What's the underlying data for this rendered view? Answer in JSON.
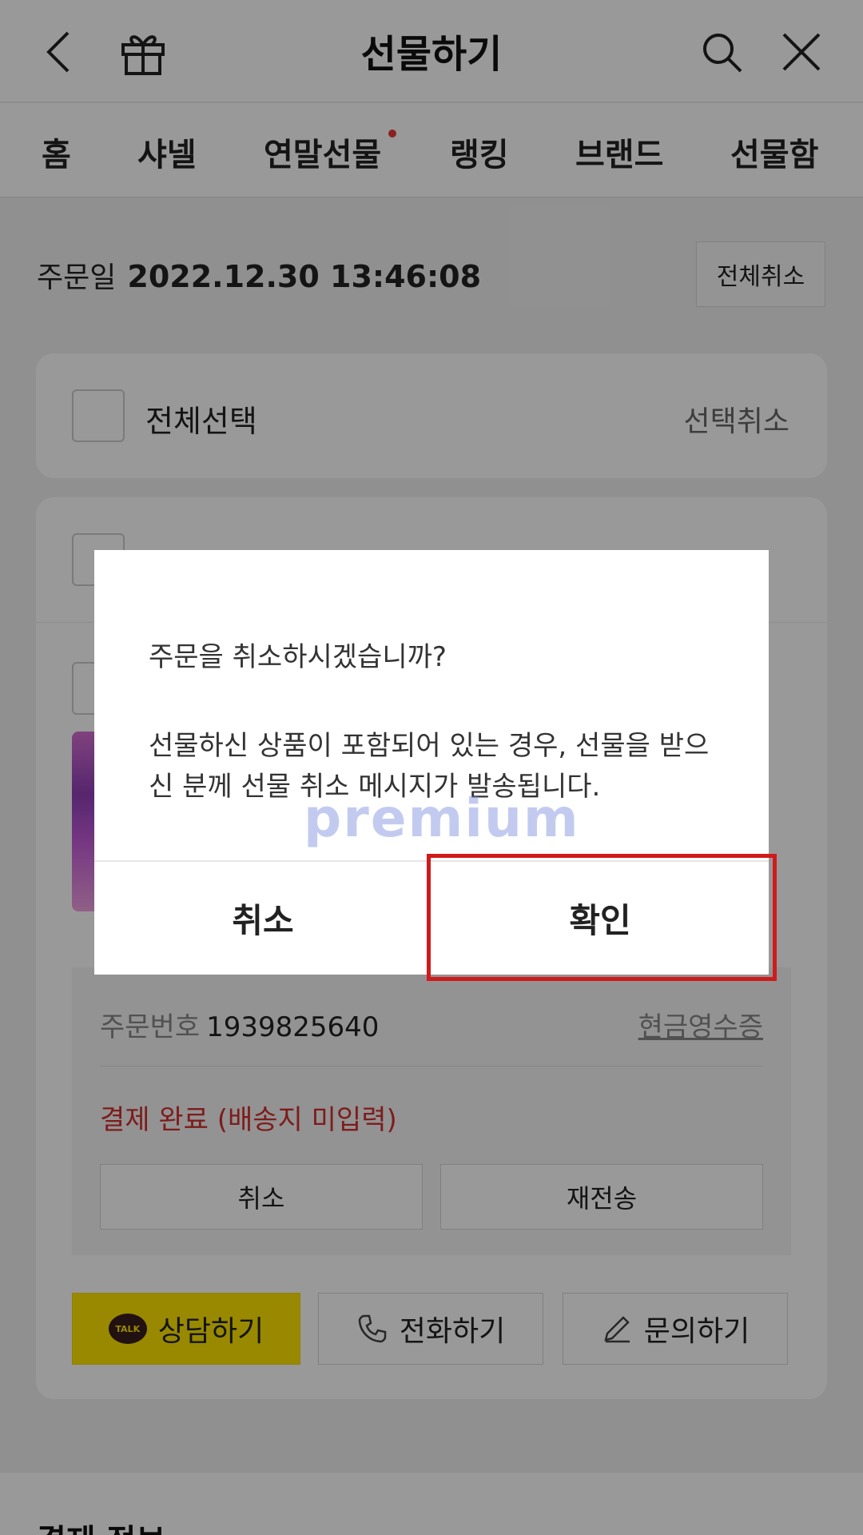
{
  "header": {
    "title": "선물하기"
  },
  "nav": {
    "items": [
      "홈",
      "샤넬",
      "연말선물",
      "랭킹",
      "브랜드",
      "선물함"
    ]
  },
  "order": {
    "date_label": "주문일",
    "date_value": "2022.12.30  13:46:08",
    "cancel_all": "전체취소"
  },
  "select": {
    "select_all": "전체선택",
    "select_cancel": "선택취소"
  },
  "order_detail": {
    "order_no_label": "주문번호",
    "order_no": "1939825640",
    "receipt": "현금영수증",
    "status": "결제 완료 (배송지 미입력)",
    "cancel": "취소",
    "resend": "재전송"
  },
  "actions": {
    "chat": "상담하기",
    "call": "전화하기",
    "inquiry": "문의하기",
    "talk_badge": "TALK"
  },
  "payment": {
    "title": "결제 정보"
  },
  "dialog": {
    "question": "주문을 취소하시겠습니까?",
    "message": "선물하신 상품이 포함되어 있는 경우, 선물을 받으신 분께 선물 취소 메시지가 발송됩니다.",
    "cancel": "취소",
    "confirm": "확인"
  },
  "watermark": "premium",
  "colors": {
    "accent_yellow": "#fee500",
    "status_red": "#d32f2f",
    "highlight_red": "#d01b1b",
    "overlay": "rgba(0,0,0,0.4)"
  }
}
